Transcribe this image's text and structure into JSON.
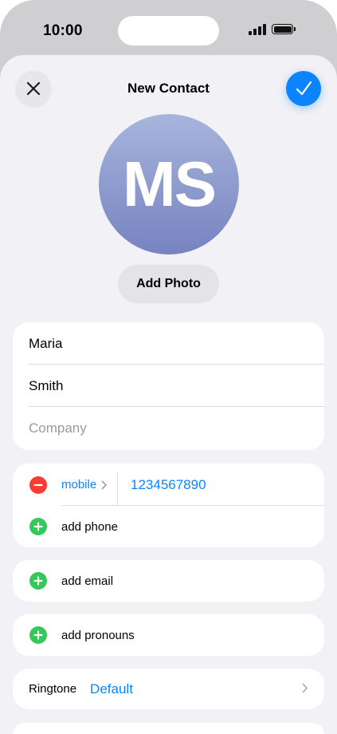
{
  "status_bar": {
    "time": "10:00"
  },
  "nav": {
    "title": "New Contact",
    "close_icon": "close-icon",
    "done_icon": "checkmark-icon"
  },
  "avatar": {
    "initials": "MS",
    "add_photo_label": "Add Photo"
  },
  "name_fields": {
    "first_name": "Maria",
    "last_name": "Smith",
    "company_placeholder": "Company"
  },
  "phone": {
    "type_label": "mobile",
    "number": "1234567890",
    "add_label": "add phone"
  },
  "email": {
    "add_label": "add email"
  },
  "pronouns": {
    "add_label": "add pronouns"
  },
  "ringtone": {
    "label": "Ringtone",
    "value": "Default"
  },
  "colors": {
    "accent": "#0a84ff",
    "remove": "#ff3b30",
    "add": "#34c759",
    "sheet_bg": "#f1f1f6",
    "avatar_top": "#a7b5dc",
    "avatar_bottom": "#7683c0"
  }
}
